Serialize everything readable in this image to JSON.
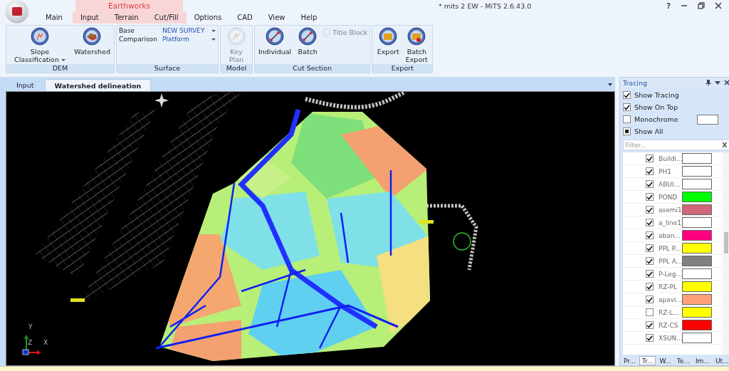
{
  "window": {
    "title": "* mits 2 EW - MiTS 2.6.43.0",
    "help": "?"
  },
  "context_group": {
    "label": "Earthworks"
  },
  "menu_tabs": [
    {
      "label": "Main",
      "context": false
    },
    {
      "label": "Input",
      "context": true
    },
    {
      "label": "Terrain",
      "context": true
    },
    {
      "label": "Cut/Fill",
      "context": true
    },
    {
      "label": "Options",
      "context": false
    },
    {
      "label": "CAD",
      "context": false
    },
    {
      "label": "View",
      "context": false
    },
    {
      "label": "Help",
      "context": false
    }
  ],
  "ribbon_groups": [
    {
      "label": "DEM",
      "kind": "buttons",
      "buttons": [
        {
          "label": "Slope Classification",
          "dropdown": true,
          "disabled": false
        },
        {
          "label": "Watershed",
          "dropdown": false,
          "disabled": false
        }
      ]
    },
    {
      "label": "Surface",
      "kind": "fields",
      "fields": [
        {
          "label": "Base",
          "value": "NEW SURVEY"
        },
        {
          "label": "Comparison",
          "value": "Platform"
        }
      ]
    },
    {
      "label": "Model",
      "kind": "buttons",
      "buttons": [
        {
          "label": "Key Plan",
          "dropdown": false,
          "disabled": true
        }
      ]
    },
    {
      "label": "Cut Section",
      "kind": "buttons",
      "buttons": [
        {
          "label": "Individual",
          "dropdown": false,
          "disabled": false
        },
        {
          "label": "Batch",
          "dropdown": false,
          "disabled": false
        }
      ],
      "small_button": {
        "label": "Title Block",
        "disabled": true
      }
    },
    {
      "label": "Export",
      "kind": "buttons",
      "buttons": [
        {
          "label": "Export",
          "dropdown": false,
          "disabled": false
        },
        {
          "label": "Batch Export",
          "dropdown": false,
          "disabled": false
        }
      ]
    }
  ],
  "document_tabs": [
    {
      "label": "Input",
      "selected": false
    },
    {
      "label": "Watershed delineation",
      "selected": true
    }
  ],
  "canvas": {
    "axis": {
      "y": "Y",
      "z": "Z",
      "x": "X"
    }
  },
  "tracing_panel": {
    "title": "Tracing",
    "options": [
      {
        "label": "Show Tracing",
        "kind": "check",
        "checked": true
      },
      {
        "label": "Show On Top",
        "kind": "check",
        "checked": true
      },
      {
        "label": "Monochrome",
        "kind": "check-color",
        "checked": false,
        "color": "#ffffff"
      },
      {
        "label": "Show All",
        "kind": "tristate",
        "checked": true
      }
    ],
    "filter": {
      "placeholder": "Filter...",
      "clear": "X"
    },
    "layers": [
      {
        "name": "Buildi...",
        "checked": true,
        "color": "#ffffff"
      },
      {
        "name": "PH1",
        "checked": true,
        "color": "#ffffff"
      },
      {
        "name": "ABUI...",
        "checked": true,
        "color": "#ffffff"
      },
      {
        "name": "POND",
        "checked": true,
        "color": "#00ff00"
      },
      {
        "name": "asemi1",
        "checked": true,
        "color": "#d06878"
      },
      {
        "name": "a_line1",
        "checked": true,
        "color": "#ffffff"
      },
      {
        "name": "aban...",
        "checked": true,
        "color": "#ff0080"
      },
      {
        "name": "PPL P...",
        "checked": true,
        "color": "#ffff00"
      },
      {
        "name": "PPL A...",
        "checked": true,
        "color": "#808080"
      },
      {
        "name": "P-Leg...",
        "checked": true,
        "color": "#ffffff"
      },
      {
        "name": "RZ-PL",
        "checked": true,
        "color": "#ffff00"
      },
      {
        "name": "apavi...",
        "checked": true,
        "color": "#ffa07a"
      },
      {
        "name": "RZ-L...",
        "checked": false,
        "color": "#ffff00"
      },
      {
        "name": "RZ-CS",
        "checked": true,
        "color": "#ff0000"
      },
      {
        "name": "XSUN...",
        "checked": true,
        "color": "#ffffff"
      }
    ],
    "bottom_tabs": [
      {
        "label": "Pr...",
        "selected": false
      },
      {
        "label": "Tr...",
        "selected": true
      },
      {
        "label": "W...",
        "selected": false
      },
      {
        "label": "Te...",
        "selected": false
      },
      {
        "label": "Im...",
        "selected": false
      },
      {
        "label": "Ut...",
        "selected": false
      }
    ]
  }
}
